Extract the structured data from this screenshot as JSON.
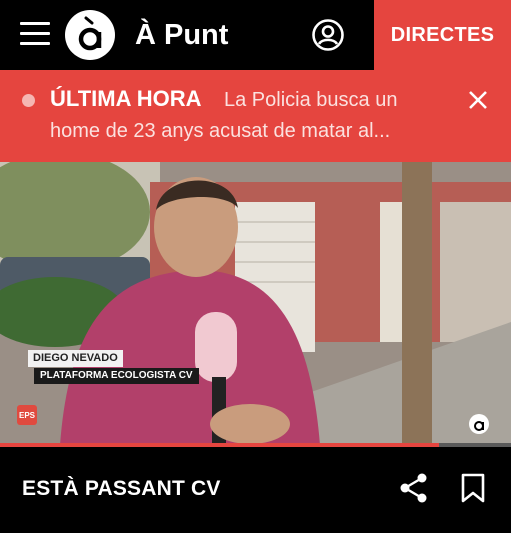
{
  "header": {
    "title": "À Punt",
    "logo_letter": "à",
    "live_button": "DIRECTES",
    "accent_color": "#e5453f"
  },
  "breaking": {
    "label": "ÚLTIMA HORA",
    "text_line1": "La Policia busca un",
    "text_line2": "home de 23 anys acusat de matar al...",
    "dot_color": "#f5b6b2"
  },
  "video": {
    "overlay_name": "DIEGO NEVADO",
    "overlay_org": "PLATAFORMA ECOLOGISTA CV",
    "mic_label": "EPS",
    "channel_mark": "EPS",
    "progress": 0.86
  },
  "bottom": {
    "now_playing": "ESTÀ PASSANT CV"
  },
  "icons": {
    "menu": "hamburger-menu-icon",
    "account": "account-icon",
    "close": "close-icon",
    "share": "share-icon",
    "bookmark": "bookmark-icon"
  }
}
